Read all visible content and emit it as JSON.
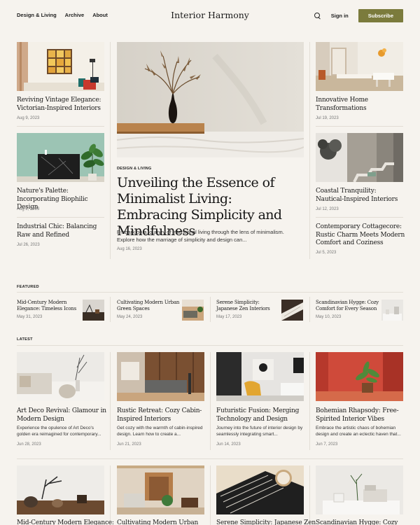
{
  "header": {
    "nav": [
      "Design & Living",
      "Archive",
      "About"
    ],
    "logo": "Interior Harmony",
    "sign_in": "Sign in",
    "subscribe": "Subscribe",
    "search_icon": "search-icon"
  },
  "top": {
    "left": [
      {
        "title": "Reviving Vintage Elegance: Victorian-Inspired Interiors",
        "date": "Aug 9, 2023"
      },
      {
        "title": "Nature's Palette: Incorporating Biophilic Design",
        "date": "Aug 2, 2023"
      },
      {
        "title": "Industrial Chic: Balancing Raw and Refined",
        "date": "Jul 26, 2023"
      }
    ],
    "hero": {
      "category": "DESIGN & LIVING",
      "title": "Unveiling the Essence of Minimalist Living: Embracing Simplicity and Mindfulness",
      "lede": "Embark on a journey of intentional living through the lens of minimalism. Explore how the marriage of simplicity and design can...",
      "date": "Aug 16, 2023"
    },
    "right": [
      {
        "title": "Innovative Home Transformations",
        "date": "Jul 19, 2023"
      },
      {
        "title": "Coastal Tranquility: Nautical-Inspired Interiors",
        "date": "Jul 12, 2023"
      },
      {
        "title": "Contemporary Cottagecore: Rustic Charm Meets Modern Comfort and Coziness",
        "date": "Jul 5, 2023"
      }
    ]
  },
  "featured": {
    "label": "FEATURED",
    "items": [
      {
        "title": "Mid-Century Modern Elegance: Timeless Icons",
        "date": "May 31, 2023"
      },
      {
        "title": "Cultivating Modern Urban Green Spaces",
        "date": "May 24, 2023"
      },
      {
        "title": "Serene Simplicity: Japanese Zen Interiors",
        "date": "May 17, 2023"
      },
      {
        "title": "Scandinavian Hygge: Cozy Comfort for Every Season",
        "date": "May 10, 2023"
      }
    ]
  },
  "latest": {
    "label": "LATEST",
    "items": [
      {
        "title": "Art Deco Revival: Glamour in Modern Design",
        "desc": "Experience the opulence of Art Deco's golden era reimagined for contemporary...",
        "date": "Jun 28, 2023"
      },
      {
        "title": "Rustic Retreat: Cozy Cabin-Inspired Interiors",
        "desc": "Get cozy with the warmth of cabin-inspired design. Learn how to create a...",
        "date": "Jun 21, 2023"
      },
      {
        "title": "Futuristic Fusion: Merging Technology and Design",
        "desc": "Journey into the future of interior design by seamlessly integrating smart...",
        "date": "Jun 14, 2023"
      },
      {
        "title": "Bohemian Rhapsody: Free-Spirited Interior Vibes",
        "desc": "Embrace the artistic chaos of bohemian design and create an eclectic haven that...",
        "date": "Jun 7, 2023"
      }
    ],
    "row2": [
      {
        "title": "Mid-Century Modern Elegance:"
      },
      {
        "title": "Cultivating Modern Urban"
      },
      {
        "title": "Serene Simplicity: Japanese Zen"
      },
      {
        "title": "Scandinavian Hygge: Cozy"
      }
    ]
  }
}
